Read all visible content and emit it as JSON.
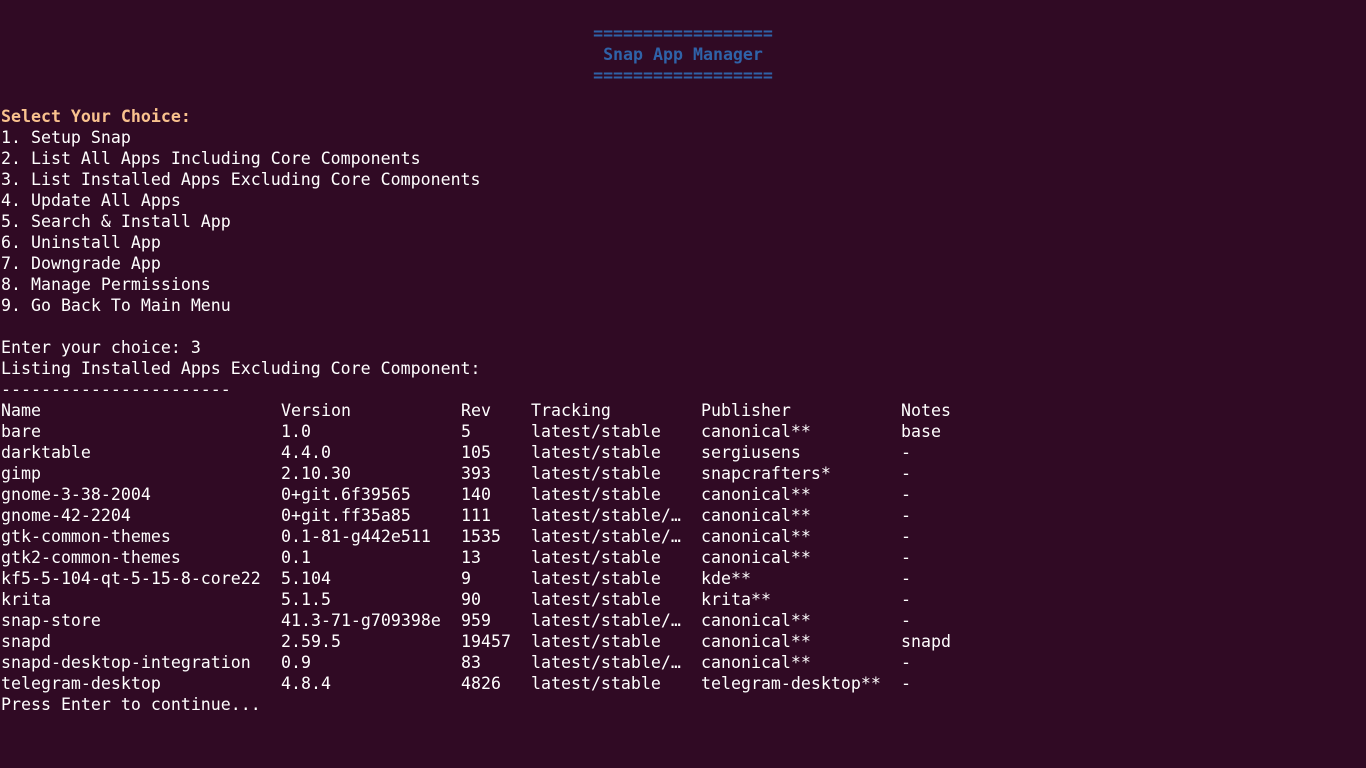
{
  "banner": {
    "rule_top": "==================",
    "title": "Snap App Manager",
    "rule_bottom": "=================="
  },
  "menu": {
    "heading": "Select Your Choice:",
    "items": [
      "1. Setup Snap",
      "2. List All Apps Including Core Components",
      "3. List Installed Apps Excluding Core Components",
      "4. Update All Apps",
      "5. Search & Install App",
      "6. Uninstall App",
      "7. Downgrade App",
      "8. Manage Permissions",
      "9. Go Back To Main Menu"
    ]
  },
  "prompt": {
    "text": "Enter your choice: 3"
  },
  "listing": {
    "title": "Listing Installed Apps Excluding Core Component:",
    "separator": "-----------------------",
    "headers": [
      "Name",
      "Version",
      "Rev",
      "Tracking",
      "Publisher",
      "Notes"
    ],
    "rows": [
      [
        "bare",
        "1.0",
        "5",
        "latest/stable",
        "canonical**",
        "base"
      ],
      [
        "darktable",
        "4.4.0",
        "105",
        "latest/stable",
        "sergiusens",
        "-"
      ],
      [
        "gimp",
        "2.10.30",
        "393",
        "latest/stable",
        "snapcrafters*",
        "-"
      ],
      [
        "gnome-3-38-2004",
        "0+git.6f39565",
        "140",
        "latest/stable",
        "canonical**",
        "-"
      ],
      [
        "gnome-42-2204",
        "0+git.ff35a85",
        "111",
        "latest/stable/…",
        "canonical**",
        "-"
      ],
      [
        "gtk-common-themes",
        "0.1-81-g442e511",
        "1535",
        "latest/stable/…",
        "canonical**",
        "-"
      ],
      [
        "gtk2-common-themes",
        "0.1",
        "13",
        "latest/stable",
        "canonical**",
        "-"
      ],
      [
        "kf5-5-104-qt-5-15-8-core22",
        "5.104",
        "9",
        "latest/stable",
        "kde**",
        "-"
      ],
      [
        "krita",
        "5.1.5",
        "90",
        "latest/stable",
        "krita**",
        "-"
      ],
      [
        "snap-store",
        "41.3-71-g709398e",
        "959",
        "latest/stable/…",
        "canonical**",
        "-"
      ],
      [
        "snapd",
        "2.59.5",
        "19457",
        "latest/stable",
        "canonical**",
        "snapd"
      ],
      [
        "snapd-desktop-integration",
        "0.9",
        "83",
        "latest/stable/…",
        "canonical**",
        "-"
      ],
      [
        "telegram-desktop",
        "4.8.4",
        "4826",
        "latest/stable",
        "telegram-desktop**",
        "-"
      ]
    ]
  },
  "footer": {
    "text": "Press Enter to continue..."
  },
  "colors": {
    "background": "#300a24",
    "banner": "#2f62a8",
    "heading": "#f9c28e",
    "text": "#ffffff"
  }
}
